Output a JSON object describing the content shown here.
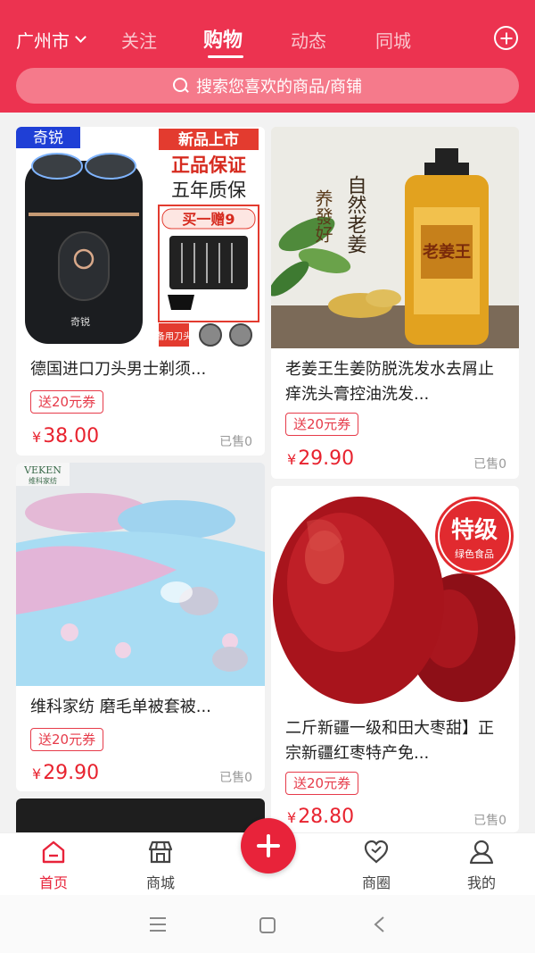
{
  "header": {
    "city": "广州市",
    "tabs": [
      "关注",
      "购物",
      "动态",
      "同城"
    ],
    "active_tab": "购物",
    "search_placeholder": "搜索您喜欢的商品/商铺"
  },
  "products": [
    {
      "title": "德国进口刀头男士剃须...",
      "coupon": "送20元券",
      "price": "38.00",
      "currency": "¥",
      "sold": "已售0",
      "image_text": {
        "brand_badge": "奇锐",
        "banner1": "新品上市",
        "banner2": "正品保证",
        "banner3": "五年质保",
        "promo": "买一赠9",
        "spare_label": "备用刀头",
        "device_brand": "奇锐"
      }
    },
    {
      "title": "老姜王生姜防脱洗发水去屑止痒洗头膏控油洗发...",
      "coupon": "送20元券",
      "price": "29.90",
      "currency": "¥",
      "sold": "已售0",
      "image_text": {
        "calligraphy1": "自然老姜",
        "calligraphy2": "养發好",
        "bottle_label": "老姜王"
      }
    },
    {
      "title": "维科家纺 磨毛单被套被...",
      "coupon": "送20元券",
      "price": "29.90",
      "currency": "¥",
      "sold": "已售0",
      "image_text": {
        "brand_logo": "VEKEN",
        "brand_sub": "维科家纺"
      }
    },
    {
      "title": "二斤新疆一级和田大枣甜】正宗新疆红枣特产免...",
      "coupon": "送20元券",
      "price": "28.80",
      "currency": "¥",
      "sold": "已售0",
      "image_text": {
        "badge_big": "特级",
        "badge_small": "绿色食品"
      }
    }
  ],
  "bottom_nav": [
    {
      "label": "首页",
      "icon": "home-icon",
      "active": true
    },
    {
      "label": "商城",
      "icon": "shop-icon",
      "active": false
    },
    {
      "label": "",
      "icon": "plus-icon",
      "active": false
    },
    {
      "label": "商圈",
      "icon": "heart-icon",
      "active": false
    },
    {
      "label": "我的",
      "icon": "user-icon",
      "active": false
    }
  ],
  "colors": {
    "brand": "#ec3350",
    "price": "#e8232f",
    "nav_active": "#e8233a"
  }
}
